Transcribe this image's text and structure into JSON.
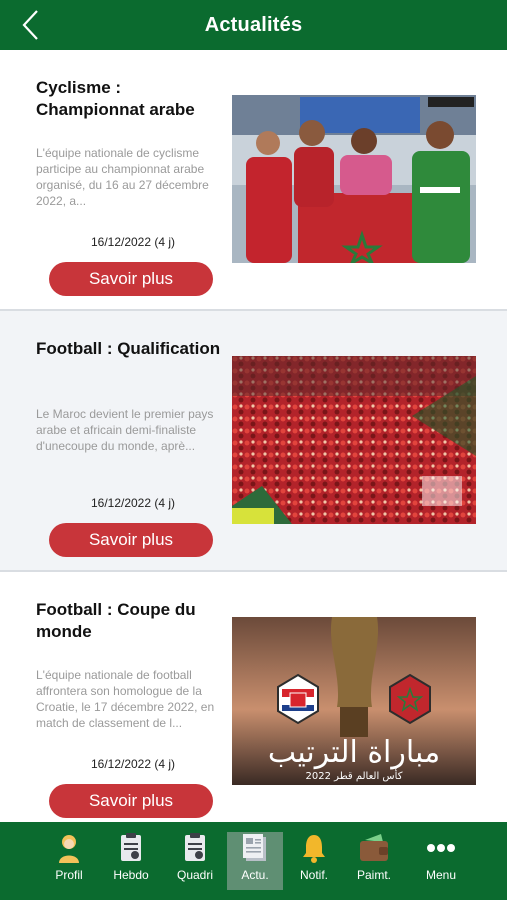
{
  "header": {
    "title": "Actualités"
  },
  "articles": [
    {
      "title": "Cyclisme : Championnat arabe",
      "excerpt": "L'équipe nationale de cyclisme participe au championnat arabe organisé, du 16 au 27 décembre 2022, a...",
      "date": "16/12/2022 (4 j)",
      "button": "Savoir plus",
      "image": "cyclists-podium-photo"
    },
    {
      "title": "Football : Qualification",
      "excerpt": "Le Maroc devient le premier pays arabe et africain demi-finaliste d'unecoupe du monde, aprè...",
      "date": "16/12/2022 (4 j)",
      "button": "Savoir plus",
      "image": "stadium-crowd-photo"
    },
    {
      "title": "Football : Coupe du monde",
      "excerpt": "L'équipe nationale de football affrontera son homologue de la Croatie, le 17 décembre 2022, en match de classement de l...",
      "date": "16/12/2022 (4 j)",
      "button": "Savoir plus",
      "image": "world-cup-match-poster",
      "poster": {
        "arabic_title": "مباراة الترتيب",
        "arabic_subtitle": "كأس العالم قطر 2022"
      }
    }
  ],
  "tabs": [
    {
      "label": "Profil",
      "icon": "profile-icon"
    },
    {
      "label": "Hebdo",
      "icon": "weekly-doc-icon"
    },
    {
      "label": "Quadri",
      "icon": "clipboard-icon"
    },
    {
      "label": "Actu.",
      "icon": "news-icon",
      "active": true
    },
    {
      "label": "Notif.",
      "icon": "bell-icon"
    },
    {
      "label": "Paimt.",
      "icon": "wallet-icon"
    },
    {
      "label": "Menu",
      "icon": "more-icon"
    }
  ],
  "colors": {
    "header": "#0b6b2f",
    "button": "#c8353a",
    "active_tab": "#5f8f73"
  }
}
